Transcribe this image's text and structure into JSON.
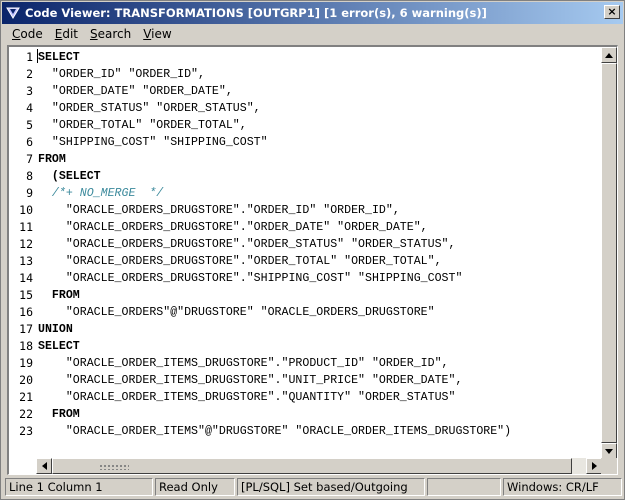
{
  "window": {
    "title": "Code Viewer: TRANSFORMATIONS [OUTGRP1] [1 error(s), 6 warning(s)]",
    "close_glyph": "×"
  },
  "menu": [
    {
      "label_u": "C",
      "label_rest": "ode"
    },
    {
      "label_u": "E",
      "label_rest": "dit"
    },
    {
      "label_u": "S",
      "label_rest": "earch"
    },
    {
      "label_u": "V",
      "label_rest": "iew"
    }
  ],
  "editor": {
    "lines": [
      {
        "no": "1",
        "text": "SELECT",
        "style": "kw"
      },
      {
        "no": "2",
        "text": "  \"ORDER_ID\" \"ORDER_ID\",",
        "style": ""
      },
      {
        "no": "3",
        "text": "  \"ORDER_DATE\" \"ORDER_DATE\",",
        "style": ""
      },
      {
        "no": "4",
        "text": "  \"ORDER_STATUS\" \"ORDER_STATUS\",",
        "style": ""
      },
      {
        "no": "5",
        "text": "  \"ORDER_TOTAL\" \"ORDER_TOTAL\",",
        "style": ""
      },
      {
        "no": "6",
        "text": "  \"SHIPPING_COST\" \"SHIPPING_COST\"",
        "style": ""
      },
      {
        "no": "7",
        "text": "FROM",
        "style": "kw"
      },
      {
        "no": "8",
        "text": "  (SELECT",
        "style": "kw"
      },
      {
        "no": "9",
        "text": "  /*+ NO_MERGE  */",
        "style": "comment"
      },
      {
        "no": "10",
        "text": "    \"ORACLE_ORDERS_DRUGSTORE\".\"ORDER_ID\" \"ORDER_ID\",",
        "style": ""
      },
      {
        "no": "11",
        "text": "    \"ORACLE_ORDERS_DRUGSTORE\".\"ORDER_DATE\" \"ORDER_DATE\",",
        "style": ""
      },
      {
        "no": "12",
        "text": "    \"ORACLE_ORDERS_DRUGSTORE\".\"ORDER_STATUS\" \"ORDER_STATUS\",",
        "style": ""
      },
      {
        "no": "13",
        "text": "    \"ORACLE_ORDERS_DRUGSTORE\".\"ORDER_TOTAL\" \"ORDER_TOTAL\",",
        "style": ""
      },
      {
        "no": "14",
        "text": "    \"ORACLE_ORDERS_DRUGSTORE\".\"SHIPPING_COST\" \"SHIPPING_COST\"",
        "style": ""
      },
      {
        "no": "15",
        "text": "  FROM",
        "style": "kw"
      },
      {
        "no": "16",
        "text": "    \"ORACLE_ORDERS\"@\"DRUGSTORE\" \"ORACLE_ORDERS_DRUGSTORE\"",
        "style": ""
      },
      {
        "no": "17",
        "text": "UNION",
        "style": "kw"
      },
      {
        "no": "18",
        "text": "SELECT",
        "style": "kw"
      },
      {
        "no": "19",
        "text": "    \"ORACLE_ORDER_ITEMS_DRUGSTORE\".\"PRODUCT_ID\" \"ORDER_ID\",",
        "style": ""
      },
      {
        "no": "20",
        "text": "    \"ORACLE_ORDER_ITEMS_DRUGSTORE\".\"UNIT_PRICE\" \"ORDER_DATE\",",
        "style": ""
      },
      {
        "no": "21",
        "text": "    \"ORACLE_ORDER_ITEMS_DRUGSTORE\".\"QUANTITY\" \"ORDER_STATUS\"",
        "style": ""
      },
      {
        "no": "22",
        "text": "  FROM",
        "style": "kw"
      },
      {
        "no": "23",
        "text": "    \"ORACLE_ORDER_ITEMS\"@\"DRUGSTORE\" \"ORACLE_ORDER_ITEMS_DRUGSTORE\")",
        "style": ""
      }
    ]
  },
  "status": {
    "position": "Line 1 Column 1",
    "mode": "Read Only",
    "language": "[PL/SQL] Set based/Outgoing",
    "empty": "",
    "line_endings": "Windows: CR/LF"
  },
  "colors": {
    "title_bar_start": "#0a246a",
    "title_bar_end": "#a6caf0",
    "comment": "#3c8a9c",
    "chrome": "#d4d0c8"
  }
}
